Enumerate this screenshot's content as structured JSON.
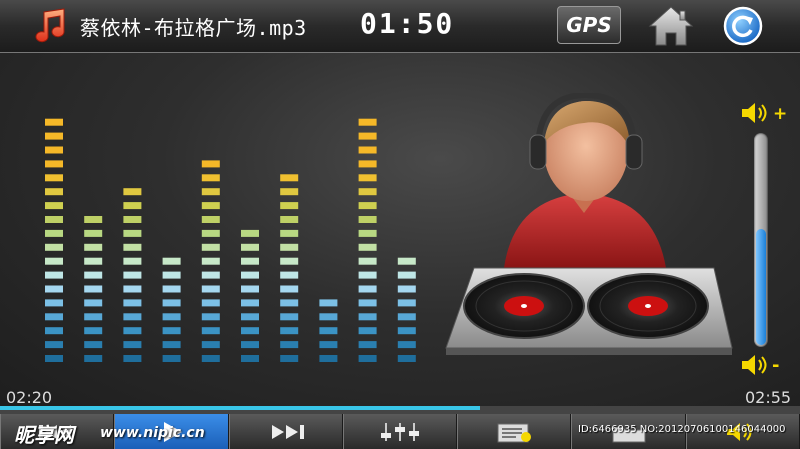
{
  "header": {
    "song_title": "蔡依林-布拉格广场.mp3",
    "clock": "01:50",
    "gps_label": "GPS",
    "icons": [
      "music-note-icon",
      "home-icon",
      "refresh-icon"
    ]
  },
  "equalizer": {
    "levels": [
      18,
      11,
      13,
      8,
      15,
      10,
      14,
      5,
      18,
      8
    ],
    "max_segments": 18
  },
  "playback": {
    "elapsed": "02:20",
    "total": "02:55",
    "progress_percent": 60
  },
  "volume": {
    "level_percent": 56,
    "up_label": "+",
    "down_label": "-"
  },
  "controls": [
    "previous-icon",
    "play-icon",
    "next-icon",
    "equalizer-icon",
    "playlist-icon",
    "folder-icon",
    "volume-icon"
  ],
  "watermark": {
    "logo": "昵享网",
    "url": "www.nipic.cn",
    "id": "ID:6466935 NO:20120706100146044000"
  },
  "colors": {
    "accent": "#39c6e8",
    "active_button": "#2a7be0",
    "speaker": "#f5d800"
  }
}
